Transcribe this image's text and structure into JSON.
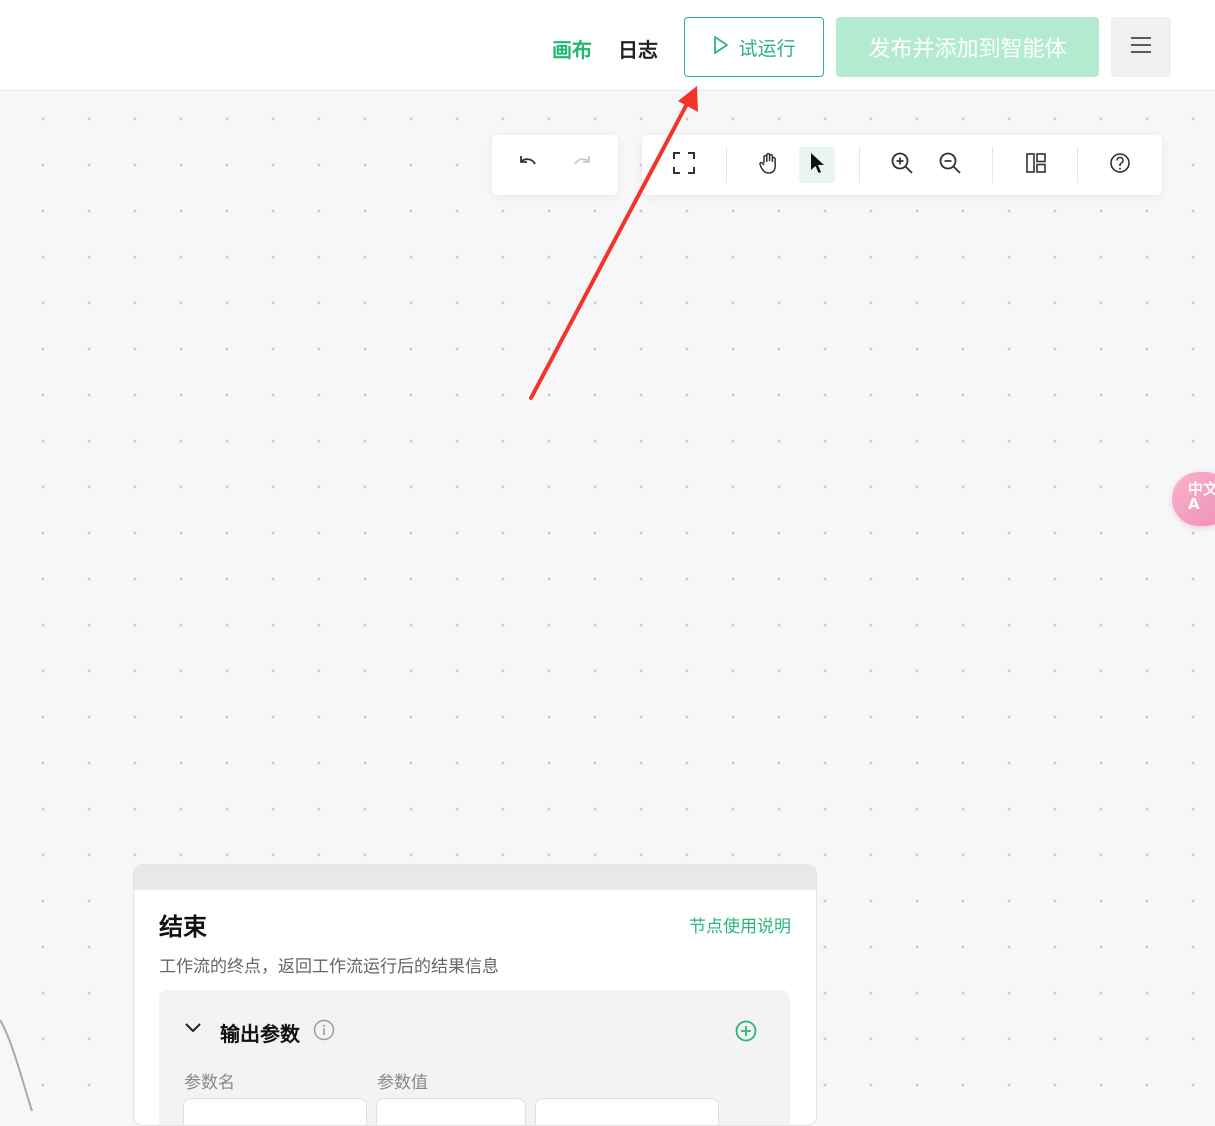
{
  "header": {
    "tabs": [
      {
        "label": "画布",
        "active": true
      },
      {
        "label": "日志",
        "active": false
      }
    ],
    "trial_run_label": "试运行",
    "publish_label": "发布并添加到智能体"
  },
  "toolbar": {
    "history": [
      "undo-icon",
      "redo-icon"
    ],
    "tools": [
      "fullscreen-icon",
      "hand-icon",
      "pointer-icon",
      "zoom-in-icon",
      "zoom-out-icon",
      "layout-icon",
      "help-icon"
    ],
    "active_tool": "pointer-icon"
  },
  "side_badge": {
    "label": "中文",
    "sub": "A"
  },
  "colors": {
    "accent": "#2cb57a",
    "annotation_arrow": "#f2342a"
  },
  "end_node": {
    "title": "结束",
    "help_link": "节点使用说明",
    "description": "工作流的终点，返回工作流运行后的结果信息",
    "output": {
      "title": "输出参数",
      "col_name": "参数名",
      "col_value": "参数值"
    }
  }
}
